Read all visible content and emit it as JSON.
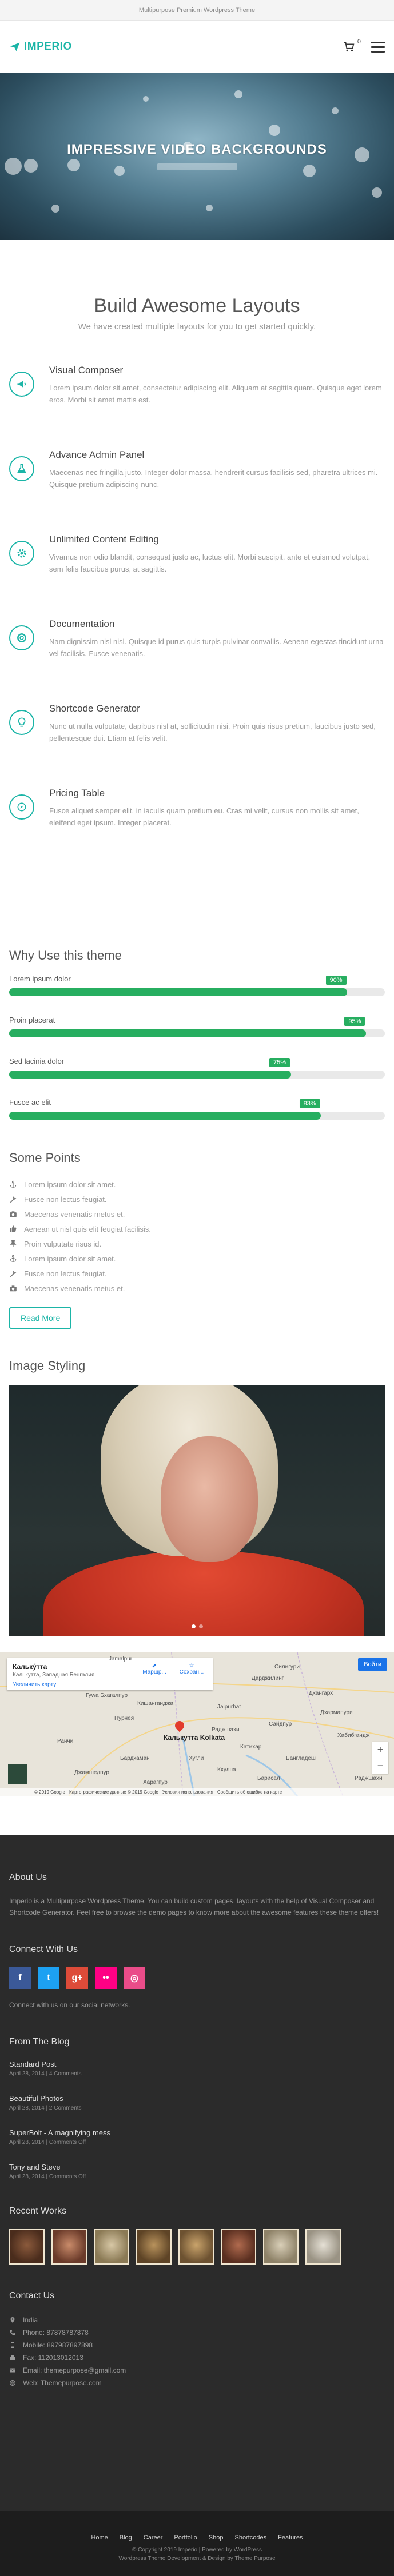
{
  "topbar": {
    "text": "Multipurpose Premium Wordpress Theme"
  },
  "header": {
    "logo": "IMPERIO",
    "cart_count": "0"
  },
  "hero": {
    "title": "IMPRESSIVE VIDEO BACKGROUNDS"
  },
  "layouts": {
    "title": "Build Awesome Layouts",
    "subtitle": "We have created multiple layouts for you to get started quickly.",
    "features": [
      {
        "title": "Visual Composer",
        "text": "Lorem ipsum dolor sit amet, consectetur adipiscing elit. Aliquam at sagittis quam. Quisque eget lorem eros. Morbi sit amet mattis est.",
        "icon": "megaphone-icon"
      },
      {
        "title": "Advance Admin Panel",
        "text": "Maecenas nec fringilla justo. Integer dolor massa, hendrerit cursus facilisis sed, pharetra ultrices mi. Quisque pretium adipiscing nunc.",
        "icon": "flask-icon"
      },
      {
        "title": "Unlimited Content Editing",
        "text": "Vivamus non odio blandit, consequat justo ac, luctus elit. Morbi suscipit, ante et euismod volutpat, sem felis faucibus purus, at sagittis.",
        "icon": "gear-icon"
      },
      {
        "title": "Documentation",
        "text": "Nam dignissim nisl nisl. Quisque id purus quis turpis pulvinar convallis. Aenean egestas tincidunt urna vel facilisis. Fusce venenatis.",
        "icon": "lifebuoy-icon"
      },
      {
        "title": "Shortcode Generator",
        "text": "Nunc ut nulla vulputate, dapibus nisl at, sollicitudin nisi. Proin quis risus pretium, faucibus justo sed, pellentesque dui. Etiam at felis velit.",
        "icon": "lightbulb-icon"
      },
      {
        "title": "Pricing Table",
        "text": "Fusce aliquet semper elit, in iaculis quam pretium eu. Cras mi velit, cursus non mollis sit amet, eleifend eget ipsum. Integer placerat.",
        "icon": "compass-icon"
      }
    ]
  },
  "why": {
    "title": "Why Use this theme",
    "skills": [
      {
        "label": "Lorem ipsum dolor",
        "badge": "90%",
        "value": 0.9
      },
      {
        "label": "Proin placerat",
        "badge": "95%",
        "value": 0.95
      },
      {
        "label": "Sed lacinia dolor",
        "badge": "75%",
        "value": 0.75
      },
      {
        "label": "Fusce ac elit",
        "badge": "83%",
        "value": 0.83
      }
    ]
  },
  "points": {
    "title": "Some Points",
    "items": [
      {
        "text": "Lorem ipsum dolor sit amet.",
        "icon": "anchor-icon"
      },
      {
        "text": "Fusce non lectus feugiat.",
        "icon": "wrench-icon"
      },
      {
        "text": "Maecenas venenatis metus et.",
        "icon": "camera-icon"
      },
      {
        "text": "Aenean ut nisl quis elit feugiat facilisis.",
        "icon": "thumbs-up-icon"
      },
      {
        "text": "Proin vulputate risus id.",
        "icon": "pin-icon"
      },
      {
        "text": "Lorem ipsum dolor sit amet.",
        "icon": "anchor-icon"
      },
      {
        "text": "Fusce non lectus feugiat.",
        "icon": "wrench-icon"
      },
      {
        "text": "Maecenas venenatis metus et.",
        "icon": "camera-icon"
      }
    ],
    "button": "Read More"
  },
  "styling": {
    "title": "Image Styling"
  },
  "map": {
    "place": "Кальку́тта",
    "address": "Калькутта, Западная Бенгалия",
    "link": "Увеличить карту",
    "btn_route": "Маршр...",
    "btn_save": "Сохран...",
    "view_btn": "Войти",
    "city": "Калькутта Kolkata",
    "labels": [
      "Jamalpur",
      "Гуwa Бхагалпур",
      "Кишанганджа",
      "Силигури",
      "Дхангарх",
      "Дхармапури",
      "Jaipurhat",
      "Дарджилинг",
      "Катихар",
      "Сайдпур",
      "Кхулна",
      "Барисал",
      "Бангладеш",
      "Хабибгандж",
      "Раджшахи",
      "Пурнея",
      "Бардхаман",
      "Ранчи",
      "Джамшедпур",
      "Харагпур",
      "Хугли",
      "Раджшахи"
    ],
    "footer": "© 2019 Google · Картографические данные © 2019 Google · Условия использования · Сообщить об ошибке на карте"
  },
  "footer": {
    "about_title": "About Us",
    "about_text": "Imperio is a Multipurpose Wordpress Theme. You can build custom pages, layouts with the help of Visual Composer and Shortcode Generator. Feel free to browse the demo pages to know more about the awesome features these theme offers!",
    "connect_title": "Connect With Us",
    "connect_text": "Connect with us on our social networks.",
    "socials": [
      {
        "letter": "f",
        "icon": "facebook-icon",
        "color": "#3b5998"
      },
      {
        "letter": "t",
        "icon": "twitter-icon",
        "color": "#1da1f2"
      },
      {
        "letter": "g+",
        "icon": "google-plus-icon",
        "color": "#dd4b39"
      },
      {
        "letter": "••",
        "icon": "flickr-icon",
        "color": "#ff0084"
      },
      {
        "letter": "◎",
        "icon": "dribbble-icon",
        "color": "#ea4c89"
      }
    ],
    "blog_title": "From The Blog",
    "posts": [
      {
        "title": "Standard Post",
        "meta": "April 28, 2014 | 4 Comments"
      },
      {
        "title": "Beautiful Photos",
        "meta": "April 28, 2014 | 2 Comments"
      },
      {
        "title": "SuperBolt - A magnifying mess",
        "meta": "April 28, 2014 | Comments Off"
      },
      {
        "title": "Tony and Steve",
        "meta": "April 28, 2014 | Comments Off"
      }
    ],
    "works_title": "Recent Works",
    "contact_title": "Contact Us",
    "contact": [
      {
        "text": "India",
        "icon": "map-marker-icon"
      },
      {
        "text": "Phone: 87878787878",
        "icon": "phone-icon"
      },
      {
        "text": "Mobile: 897987897898",
        "icon": "mobile-icon"
      },
      {
        "text": "Fax: 112013012013",
        "icon": "fax-icon"
      },
      {
        "text": "Email: themepurpose@gmail.com",
        "icon": "envelope-icon"
      },
      {
        "text": "Web: Themepurpose.com",
        "icon": "globe-icon"
      }
    ]
  },
  "bottom": {
    "nav": [
      "Home",
      "Blog",
      "Career",
      "Portfolio",
      "Shop",
      "Shortcodes",
      "Features"
    ],
    "copyright": "© Copyright 2019 Imperio | Powered by WordPress",
    "credit": "Wordpress Theme Development & Design by Theme Purpose"
  },
  "colors": {
    "accent": "#1bb5a7",
    "progress": "#27ae60",
    "footer_bg": "#2b2b2b",
    "bottom_bg": "#1d1d1d"
  }
}
